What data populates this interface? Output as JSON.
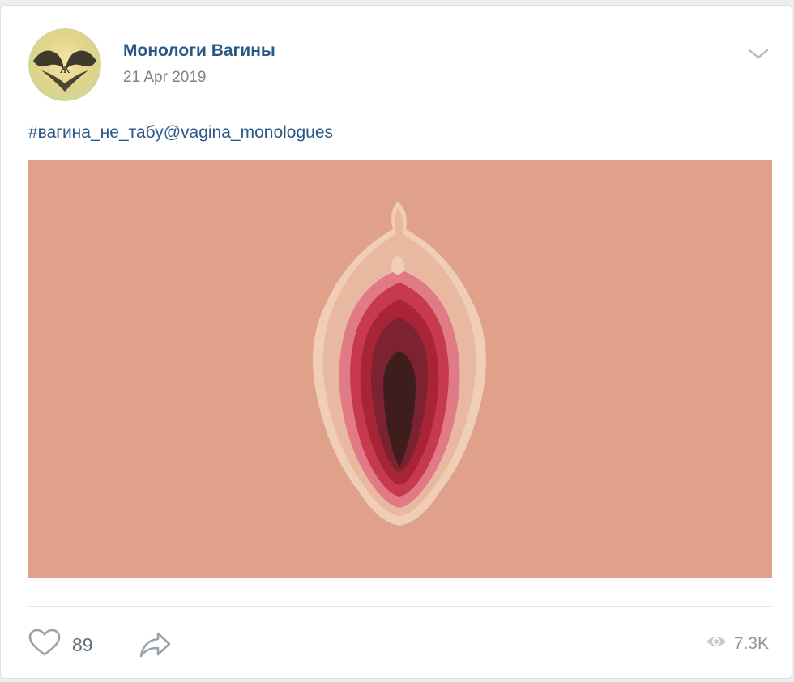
{
  "post": {
    "author": "Монологи Вагины",
    "date": "21 Apr 2019",
    "text": "#вагина_не_табу@vagina_monologues"
  },
  "actions": {
    "likes": "89",
    "views": "7.3K"
  },
  "icons": {
    "menu": "chevron-down-icon",
    "like": "heart-icon",
    "share": "share-arrow-icon",
    "views": "eye-icon"
  },
  "colors": {
    "link": "#2a5885",
    "secondary_text": "#828282",
    "icon": "#99a2ad",
    "image_background": "#dfa18a"
  }
}
